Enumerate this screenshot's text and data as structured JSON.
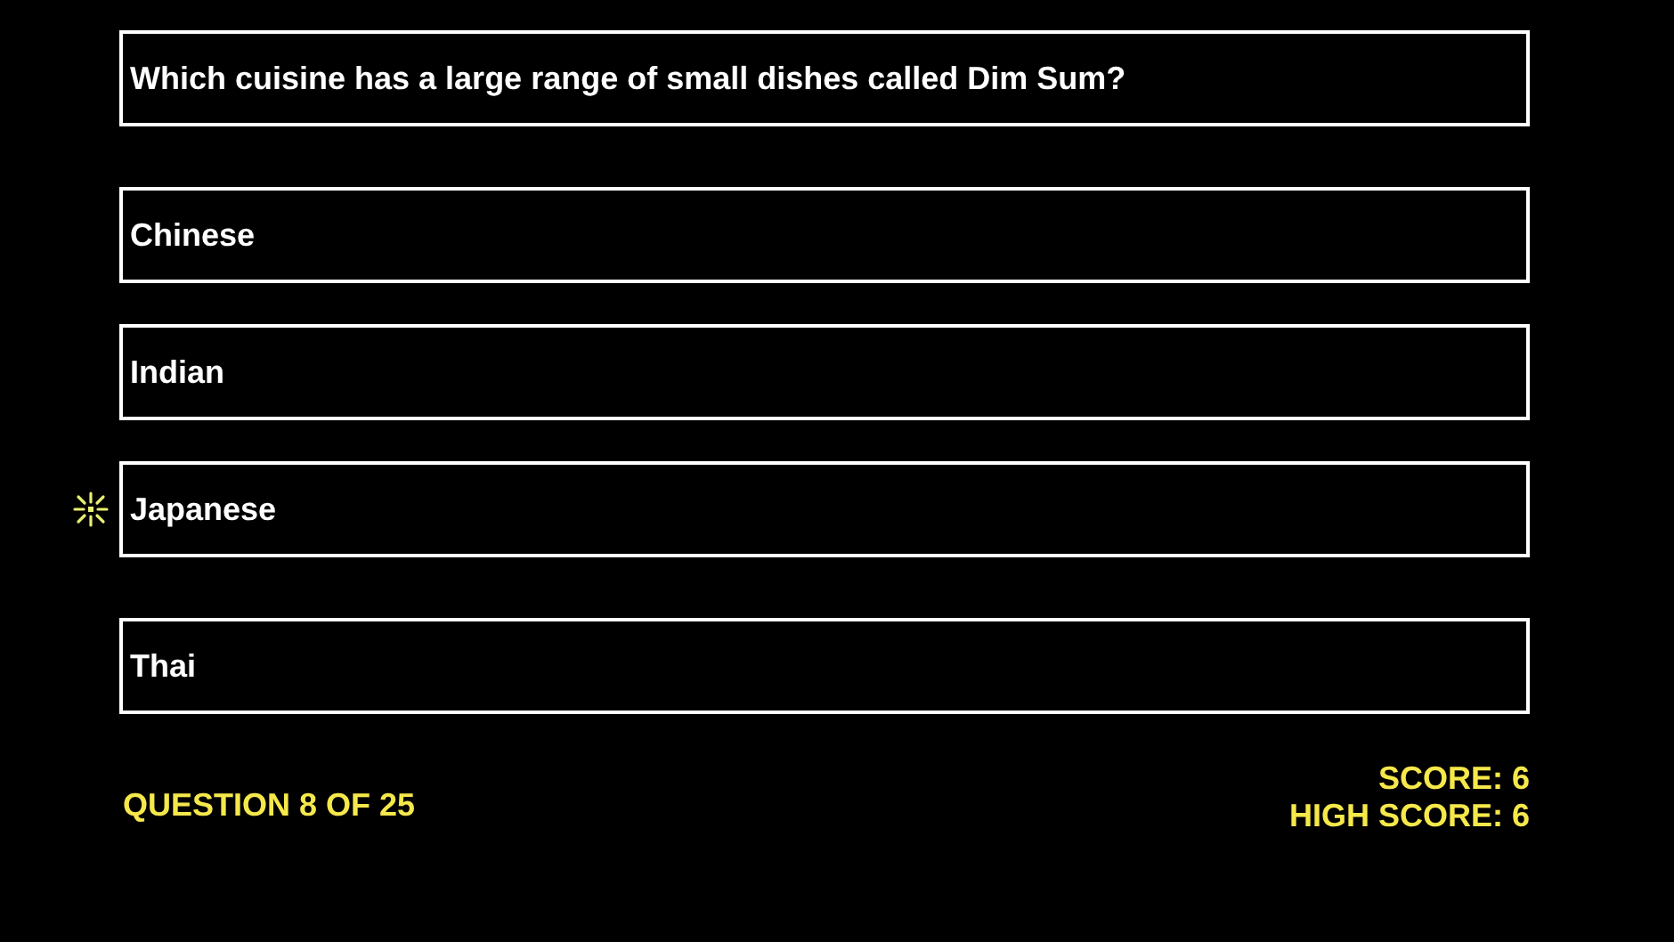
{
  "question": {
    "text": "Which cuisine has a large range of small dishes called Dim Sum?"
  },
  "answers": [
    {
      "label": "Chinese",
      "selected": false
    },
    {
      "label": "Indian",
      "selected": false
    },
    {
      "label": "Japanese",
      "selected": true
    },
    {
      "label": "Thai",
      "selected": false
    }
  ],
  "progress": "QUESTION 8 OF 25",
  "score": "SCORE: 6",
  "high_score": "HIGH SCORE: 6"
}
